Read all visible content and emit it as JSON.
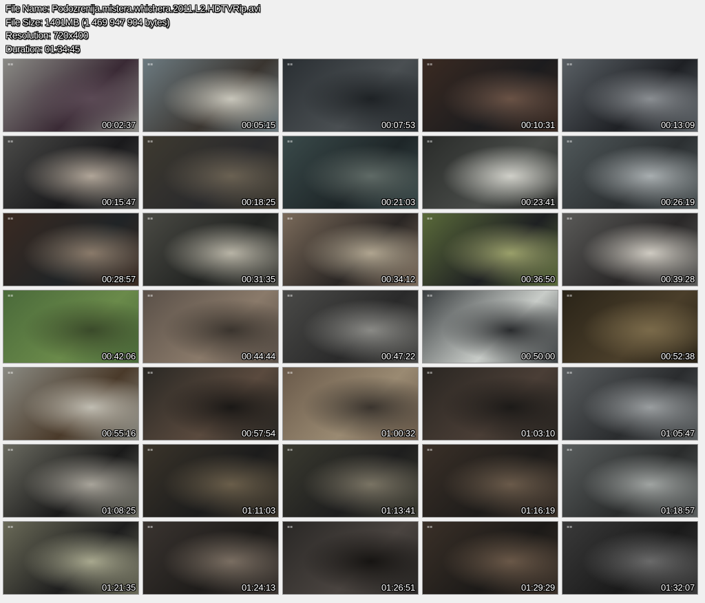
{
  "header": {
    "file_name": "File Name: Podozrenija.mistera.whichera.2011.L2.HDTVRip.avi",
    "file_size": "File Size: 1401MB (1 469 947 904 bytes)",
    "resolution": "Resolution: 720x400",
    "duration": "Duration: 01:34:45"
  },
  "thumbnails": [
    {
      "time": "00:02:37",
      "colors": [
        "#8a8a85",
        "#3a2a35",
        "#5b4a55"
      ]
    },
    {
      "time": "00:05:15",
      "colors": [
        "#6c7a80",
        "#3a3530",
        "#c8c6bb"
      ]
    },
    {
      "time": "00:07:53",
      "colors": [
        "#2a2f33",
        "#4a4f52",
        "#1e2225"
      ]
    },
    {
      "time": "00:10:31",
      "colors": [
        "#3a2a22",
        "#1c1c1e",
        "#6a5245"
      ]
    },
    {
      "time": "00:13:09",
      "colors": [
        "#5a6065",
        "#1e2024",
        "#8a8e92"
      ]
    },
    {
      "time": "00:15:47",
      "colors": [
        "#4a4a48",
        "#1a1a1c",
        "#b0a598"
      ]
    },
    {
      "time": "00:18:25",
      "colors": [
        "#3e3a30",
        "#2a2a2c",
        "#6a6152"
      ]
    },
    {
      "time": "00:21:03",
      "colors": [
        "#3a4a4a",
        "#1e2628",
        "#5f6a66"
      ]
    },
    {
      "time": "00:23:41",
      "colors": [
        "#2a2c2a",
        "#484b48",
        "#cfcfc8"
      ]
    },
    {
      "time": "00:26:19",
      "colors": [
        "#50585a",
        "#2c3032",
        "#a8aeb0"
      ]
    },
    {
      "time": "00:28:57",
      "colors": [
        "#3a2a22",
        "#202426",
        "#8a7a6a"
      ]
    },
    {
      "time": "00:31:35",
      "colors": [
        "#4a4a44",
        "#222422",
        "#b8b4a6"
      ]
    },
    {
      "time": "00:34:12",
      "colors": [
        "#7a6a5a",
        "#2a2624",
        "#b0a590"
      ]
    },
    {
      "time": "00:36:50",
      "colors": [
        "#5a6a3a",
        "#1e2022",
        "#9aa06a"
      ]
    },
    {
      "time": "00:39:28",
      "colors": [
        "#5a5a58",
        "#2a2828",
        "#cfcbc2"
      ]
    },
    {
      "time": "00:42:06",
      "colors": [
        "#4a6a3a",
        "#6a8a4a",
        "#3a4a2a"
      ]
    },
    {
      "time": "00:44:44",
      "colors": [
        "#5a5048",
        "#8a7a6a",
        "#3a342e"
      ]
    },
    {
      "time": "00:47:22",
      "colors": [
        "#4a4a48",
        "#2a2a2a",
        "#8a8a86"
      ]
    },
    {
      "time": "00:50:00",
      "colors": [
        "#3a3e40",
        "#c8ccc8",
        "#2a2c2e"
      ]
    },
    {
      "time": "00:52:38",
      "colors": [
        "#2a2418",
        "#4a3e2a",
        "#7a6a4a"
      ]
    },
    {
      "time": "00:55:16",
      "colors": [
        "#8a8a82",
        "#4a3a2a",
        "#c0bdb2"
      ]
    },
    {
      "time": "00:57:54",
      "colors": [
        "#2a2824",
        "#5a4a3e",
        "#1a1816"
      ]
    },
    {
      "time": "01:00:32",
      "colors": [
        "#6a5a4a",
        "#9a8a72",
        "#3a342e"
      ]
    },
    {
      "time": "01:03:10",
      "colors": [
        "#2a2622",
        "#4a3e36",
        "#1c1a18"
      ]
    },
    {
      "time": "01:05:47",
      "colors": [
        "#5a5e60",
        "#2a2c2e",
        "#9a9ea0"
      ]
    },
    {
      "time": "01:08:25",
      "colors": [
        "#6a6a60",
        "#1a1a1a",
        "#a8a49a"
      ]
    },
    {
      "time": "01:11:03",
      "colors": [
        "#3a342a",
        "#1c1c1c",
        "#6a5e4a"
      ]
    },
    {
      "time": "01:13:41",
      "colors": [
        "#3a3a30",
        "#1e1e1e",
        "#7a7464"
      ]
    },
    {
      "time": "01:16:19",
      "colors": [
        "#3a3028",
        "#1e1c1a",
        "#6a5a4a"
      ]
    },
    {
      "time": "01:18:57",
      "colors": [
        "#5a5e5e",
        "#2a2c2c",
        "#a0a4a2"
      ]
    },
    {
      "time": "01:21:35",
      "colors": [
        "#6a6a58",
        "#1e1e1e",
        "#a8a88e"
      ]
    },
    {
      "time": "01:24:13",
      "colors": [
        "#3a3430",
        "#1e1c1a",
        "#7a6e62"
      ]
    },
    {
      "time": "01:26:51",
      "colors": [
        "#2a2826",
        "#4a4440",
        "#161412"
      ]
    },
    {
      "time": "01:29:29",
      "colors": [
        "#3a3028",
        "#1c1a18",
        "#6a5848"
      ]
    },
    {
      "time": "01:32:07",
      "colors": [
        "#3a3a3a",
        "#1a1a1a",
        "#6a6a6a"
      ]
    }
  ]
}
